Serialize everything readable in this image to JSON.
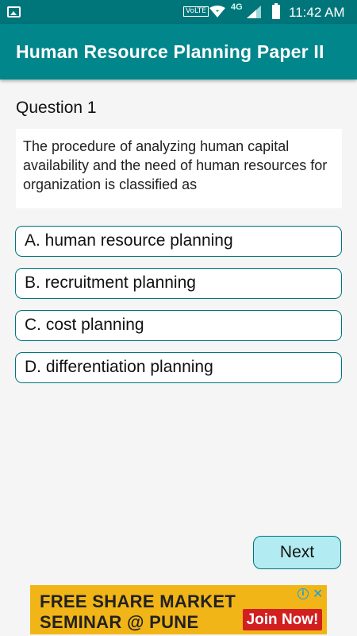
{
  "status_bar": {
    "volte": "VoLTE",
    "network": "4G",
    "time": "11:42 AM"
  },
  "app_bar": {
    "title": "Human Resource Planning Paper II"
  },
  "question": {
    "number_label": "Question 1",
    "text": "The procedure of analyzing human capital availability and the need of human resources for organization is classified as"
  },
  "options": [
    {
      "label": "A. human resource planning"
    },
    {
      "label": "B. recruitment planning"
    },
    {
      "label": "C. cost planning"
    },
    {
      "label": "D. differentiation planning"
    }
  ],
  "next_button": {
    "label": "Next"
  },
  "ad": {
    "line1": "FREE SHARE MARKET",
    "line2": "SEMINAR  @ PUNE",
    "cta": "Join Now!",
    "info_icon": "info-icon",
    "close_icon": "close-icon"
  },
  "colors": {
    "primary": "#00868b",
    "status_bar": "#00757a",
    "next_button_bg": "#b2ebf2",
    "ad_bg": "#f2b517",
    "ad_cta": "#d21f1f"
  }
}
